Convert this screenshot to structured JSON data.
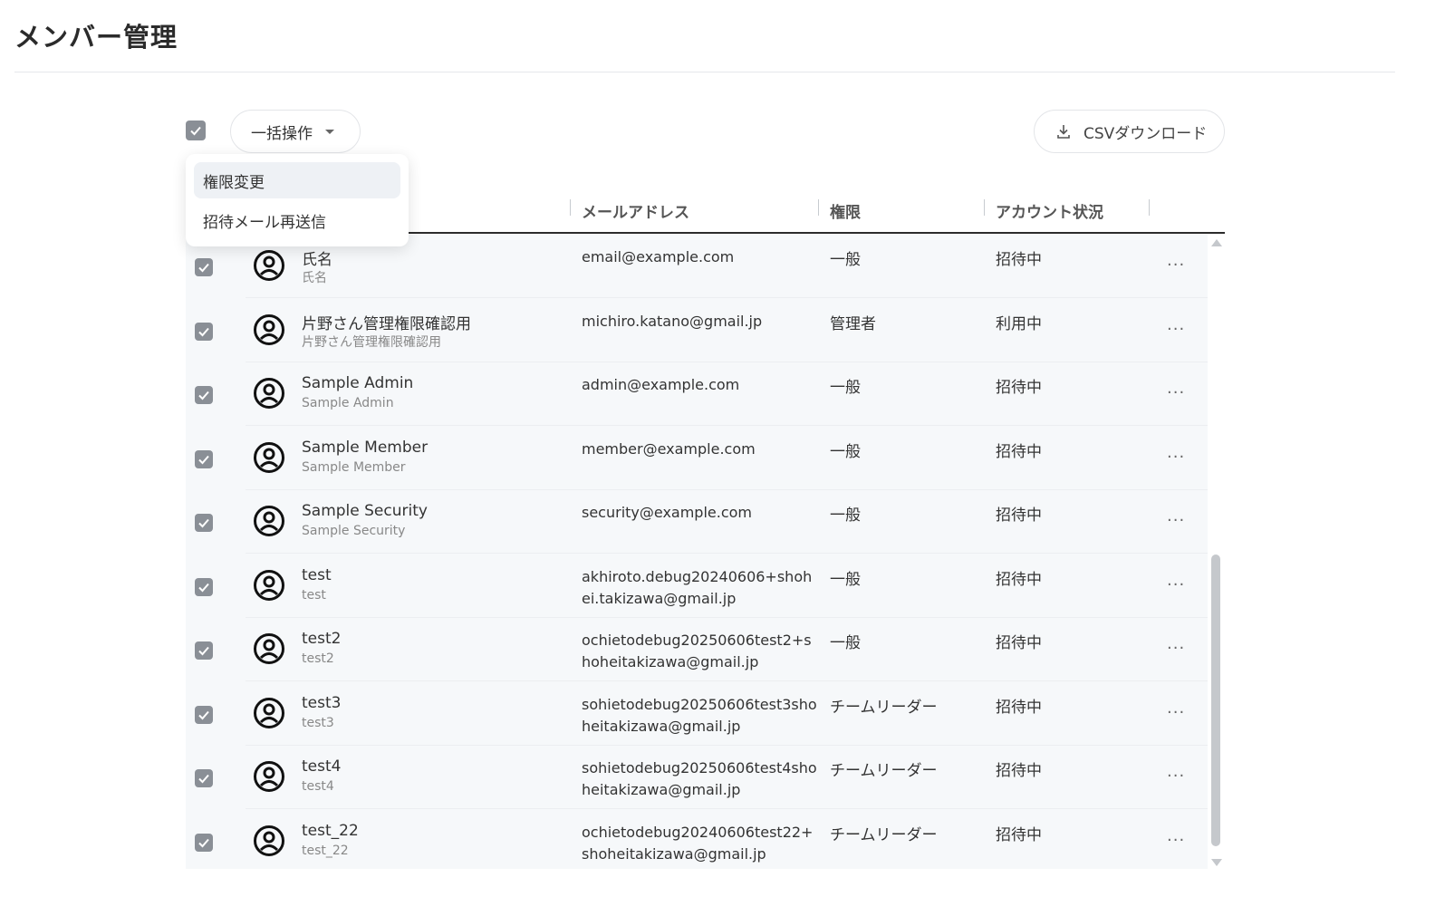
{
  "page": {
    "title": "メンバー管理"
  },
  "toolbar": {
    "bulk_label": "一括操作",
    "csv_label": "CSVダウンロード"
  },
  "dropdown": {
    "items": [
      "権限変更",
      "招待メール再送信"
    ]
  },
  "columns": {
    "email": "メールアドレス",
    "role": "権限",
    "status": "アカウント状況"
  },
  "rows": [
    {
      "name": "氏名",
      "subname": "氏名",
      "email": "email@example.com",
      "role": "一般",
      "status": "招待中"
    },
    {
      "name": "片野さん管理権限確認用",
      "subname": "片野さん管理権限確認用",
      "email": "michiro.katano@gmail.jp",
      "role": "管理者",
      "status": "利用中"
    },
    {
      "name": "Sample Admin",
      "subname": "Sample Admin",
      "email": "admin@example.com",
      "role": "一般",
      "status": "招待中"
    },
    {
      "name": "Sample Member",
      "subname": "Sample Member",
      "email": "member@example.com",
      "role": "一般",
      "status": "招待中"
    },
    {
      "name": "Sample Security",
      "subname": "Sample Security",
      "email": "security@example.com",
      "role": "一般",
      "status": "招待中"
    },
    {
      "name": "test",
      "subname": "test",
      "email": "akhiroto.debug20240606+shohei.takizawa@gmail.jp",
      "role": "一般",
      "status": "招待中"
    },
    {
      "name": "test2",
      "subname": "test2",
      "email": "ochietodebug20250606test2+shoheitakizawa@gmail.jp",
      "role": "一般",
      "status": "招待中"
    },
    {
      "name": "test3",
      "subname": "test3",
      "email": "sohietodebug20250606test3shoheitakizawa@gmail.jp",
      "role": "チームリーダー",
      "status": "招待中"
    },
    {
      "name": "test4",
      "subname": "test4",
      "email": "sohietodebug20250606test4shoheitakizawa@gmail.jp",
      "role": "チームリーダー",
      "status": "招待中"
    },
    {
      "name": "test_22",
      "subname": "test_22",
      "email": "ochietodebug20240606test22+shoheitakizawa@gmail.jp",
      "role": "チームリーダー",
      "status": "招待中"
    }
  ],
  "more_label": "...",
  "colors": {
    "checkbox": "#8a8f96",
    "table_bg": "#f6f8fa",
    "header_rule": "#2b2b2b"
  }
}
